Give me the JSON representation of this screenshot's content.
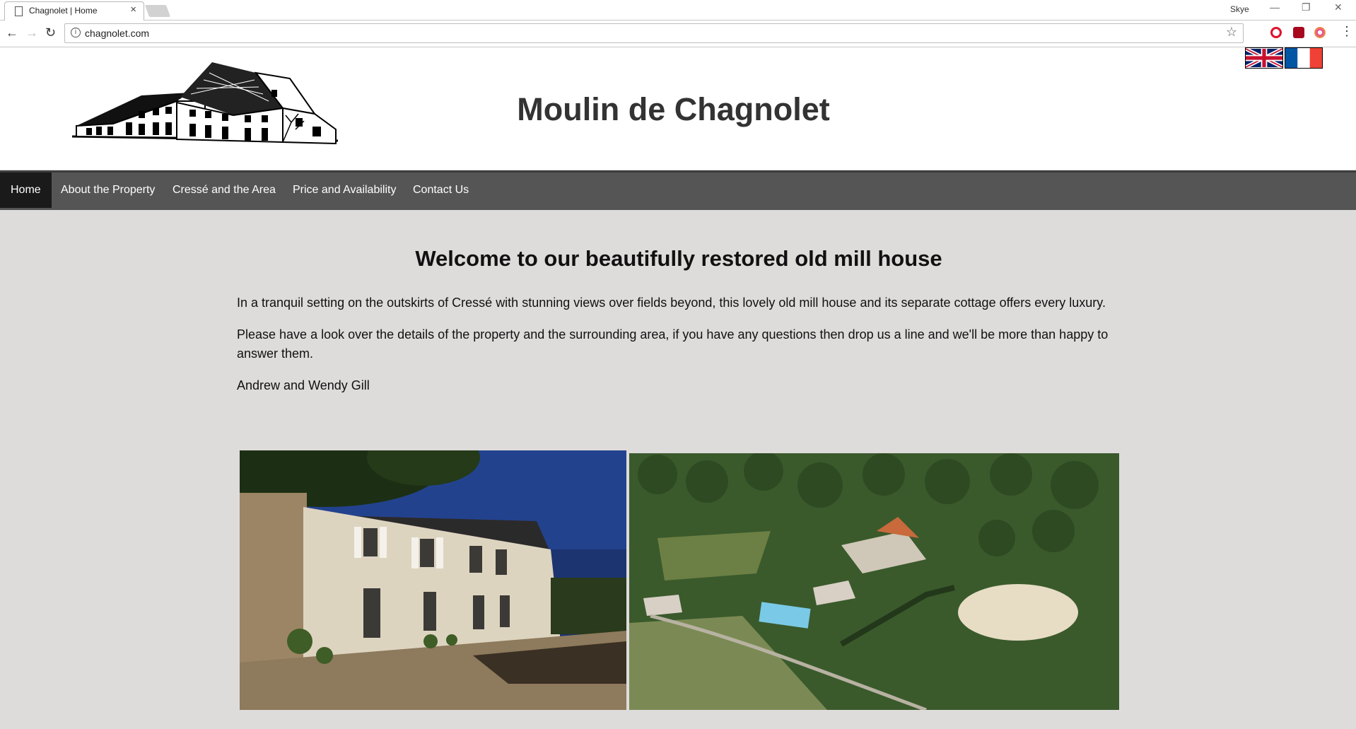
{
  "browser": {
    "tab_title": "Chagnolet | Home",
    "tab_close": "×",
    "url": "chagnolet.com",
    "user": "Skye",
    "window_controls": [
      "—",
      "❐",
      "✕"
    ]
  },
  "site": {
    "title": "Moulin de Chagnolet",
    "languages": [
      "english-flag",
      "french-flag"
    ]
  },
  "menu": {
    "items": [
      {
        "label": "Home",
        "active": true
      },
      {
        "label": "About the Property",
        "active": false
      },
      {
        "label": "Cressé and the Area",
        "active": false
      },
      {
        "label": "Price and Availability",
        "active": false
      },
      {
        "label": "Contact Us",
        "active": false
      }
    ]
  },
  "content": {
    "heading": "Welcome to our beautifully restored old mill house",
    "paragraphs": [
      "In a tranquil setting on the outskirts of Cressé with stunning views over fields beyond, this lovely old mill house and its separate cottage offers every luxury.",
      "Please have a look over the details of the property and the surrounding area, if you have any questions then drop us a line and we'll be more than happy to answer them.",
      "Andrew and Wendy Gill"
    ]
  },
  "colors": {
    "page_bg": "#dedbdb",
    "menu_bg": "#555555",
    "menu_active": "#1a1a1a"
  }
}
